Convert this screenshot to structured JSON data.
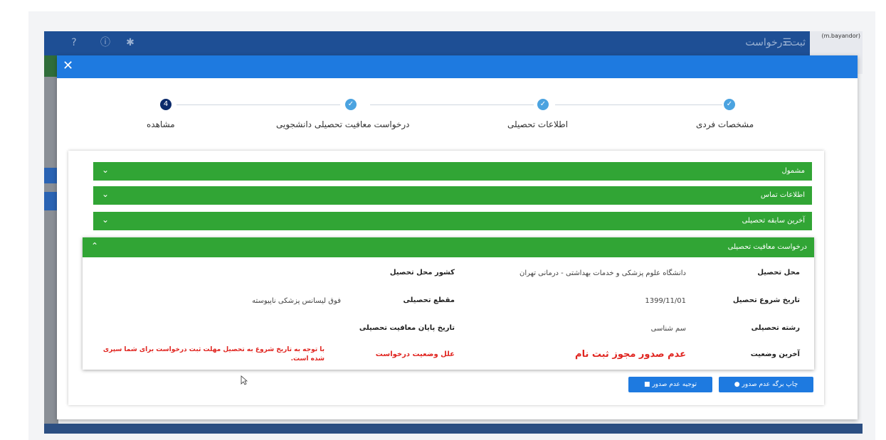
{
  "header": {
    "title": "ثبت درخواست",
    "user": "(m.bayandor)",
    "icons": [
      "help-icon",
      "info-icon",
      "gear-icon",
      "menu-icon"
    ]
  },
  "modal": {
    "close": "✕"
  },
  "stepper": {
    "steps": [
      {
        "label": "مشخصات فردی",
        "state": "done"
      },
      {
        "label": "اطلاعات تحصیلی",
        "state": "done"
      },
      {
        "label": "درخواست معافیت تحصیلی دانشجویی",
        "state": "done"
      },
      {
        "label": "مشاهده",
        "state": "active",
        "number": "4"
      }
    ]
  },
  "accordions": {
    "collapsed": [
      {
        "label": "مشمول"
      },
      {
        "label": "اطلاعات تماس"
      },
      {
        "label": "آخرین سابقه تحصیلی"
      }
    ],
    "open": {
      "label": "درخواست معافیت تحصیلی"
    }
  },
  "details": {
    "place_label": "محل تحصیل",
    "place_value": "دانشگاه علوم پزشکی و خدمات بهداشتی - درمانی تهران",
    "country_label": "کشور محل تحصیل",
    "country_value": "",
    "start_label": "تاریخ شروع تحصیل",
    "start_value": "1399/11/01",
    "level_label": "مقطع تحصیلی",
    "level_value": "فوق لیسانس پزشکی ناپیوسته",
    "field_label": "رشته تحصیلی",
    "field_value": "سم شناسی",
    "end_label": "تاریخ پایان معافیت تحصیلی",
    "end_value": "",
    "status_label": "آخرین وضعیت",
    "status_value": "عدم صدور مجوز ثبت نام",
    "reason_label": "علل وضعیت درخواست",
    "reason_value": "با توجه به تاریخ شروع به تحصیل مهلت ثبت درخواست برای شما سپری شده است."
  },
  "buttons": {
    "print": "چاپ برگه عدم صدور",
    "justify": "توجیه عدم صدور"
  },
  "colors": {
    "header": "#1e4f95",
    "topbar": "#1e7ae0",
    "green": "#31a535",
    "red": "#e0241f"
  }
}
